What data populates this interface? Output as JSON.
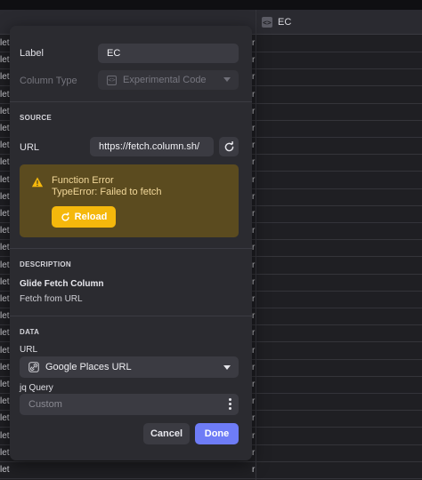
{
  "grid": {
    "column_header": "EC",
    "column_icon": "code-brackets-icon",
    "row_left_text": "let",
    "row_right_text": "r",
    "row_count": 26
  },
  "dialog": {
    "label_field": {
      "label": "Label",
      "value": "EC"
    },
    "column_type": {
      "label": "Column Type",
      "value": "Experimental Code",
      "icon": "code-brackets-icon",
      "disabled": true
    },
    "source": {
      "section_title": "SOURCE",
      "url_label": "URL",
      "url_value": "https://fetch.column.sh/",
      "refresh_icon": "refresh-icon"
    },
    "error": {
      "icon": "warning-icon",
      "title": "Function Error",
      "message": "TypeError: Failed to fetch",
      "reload_label": "Reload",
      "reload_icon": "reload-icon"
    },
    "description": {
      "section_title": "DESCRIPTION",
      "name": "Glide Fetch Column",
      "text": "Fetch from URL"
    },
    "data": {
      "section_title": "DATA",
      "url_label": "URL",
      "url_select_value": "Google Places URL",
      "url_select_icon": "link-column-icon",
      "jq_label": "jq Query",
      "jq_placeholder": "Custom"
    },
    "actions": {
      "cancel_label": "Cancel",
      "done_label": "Done"
    }
  },
  "colors": {
    "accent": "#6e7cf6",
    "warning_bg": "#5b4b1f",
    "warning_button": "#f5b80c",
    "dialog_bg": "#2b2b30",
    "page_bg": "#1f1f23"
  }
}
